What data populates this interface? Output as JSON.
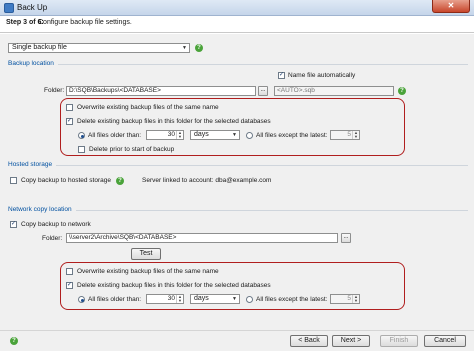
{
  "window": {
    "title": "Back Up",
    "close_glyph": "✕"
  },
  "header": {
    "step": "Step 3 of 6:",
    "description": "Configure backup file settings."
  },
  "backup_type": {
    "selected": "Single backup file"
  },
  "sections": {
    "location": "Backup location",
    "hosted": "Hosted storage",
    "network": "Network copy location"
  },
  "location": {
    "name_auto_label": "Name file automatically",
    "name_auto_checked": true,
    "folder_label": "Folder:",
    "folder_value": "D:\\SQB\\Backups\\<DATABASE>",
    "file_value": "<AUTO>.sqb",
    "overwrite_label": "Overwrite existing backup files of the same name",
    "delete_existing_label": "Delete existing backup files in this folder for the selected databases",
    "all_older_label": "All files older than:",
    "older_value": "30",
    "older_unit": "days",
    "except_latest_label": "All files except the latest:",
    "except_value": "5",
    "delete_prior_label": "Delete prior to start of backup"
  },
  "hosted": {
    "copy_label": "Copy backup to hosted storage",
    "account_text": "Server linked to account: dba@example.com"
  },
  "network": {
    "copy_label": "Copy backup to network",
    "folder_label": "Folder:",
    "folder_value": "\\\\server2\\Archive\\SQB\\<DATABASE>",
    "test_label": "Test",
    "overwrite_label": "Overwrite existing backup files of the same name",
    "delete_existing_label": "Delete existing backup files in this folder for the selected databases",
    "all_older_label": "All files older than:",
    "older_value": "30",
    "older_unit": "days",
    "except_latest_label": "All files except the latest:",
    "except_value": "5"
  },
  "footer": {
    "back": "< Back",
    "next": "Next >",
    "finish": "Finish",
    "cancel": "Cancel"
  },
  "icons": {
    "help": "?",
    "browse": "...",
    "check": "✓",
    "dropdown": "▼",
    "spin_up": "▲",
    "spin_down": "▼"
  }
}
